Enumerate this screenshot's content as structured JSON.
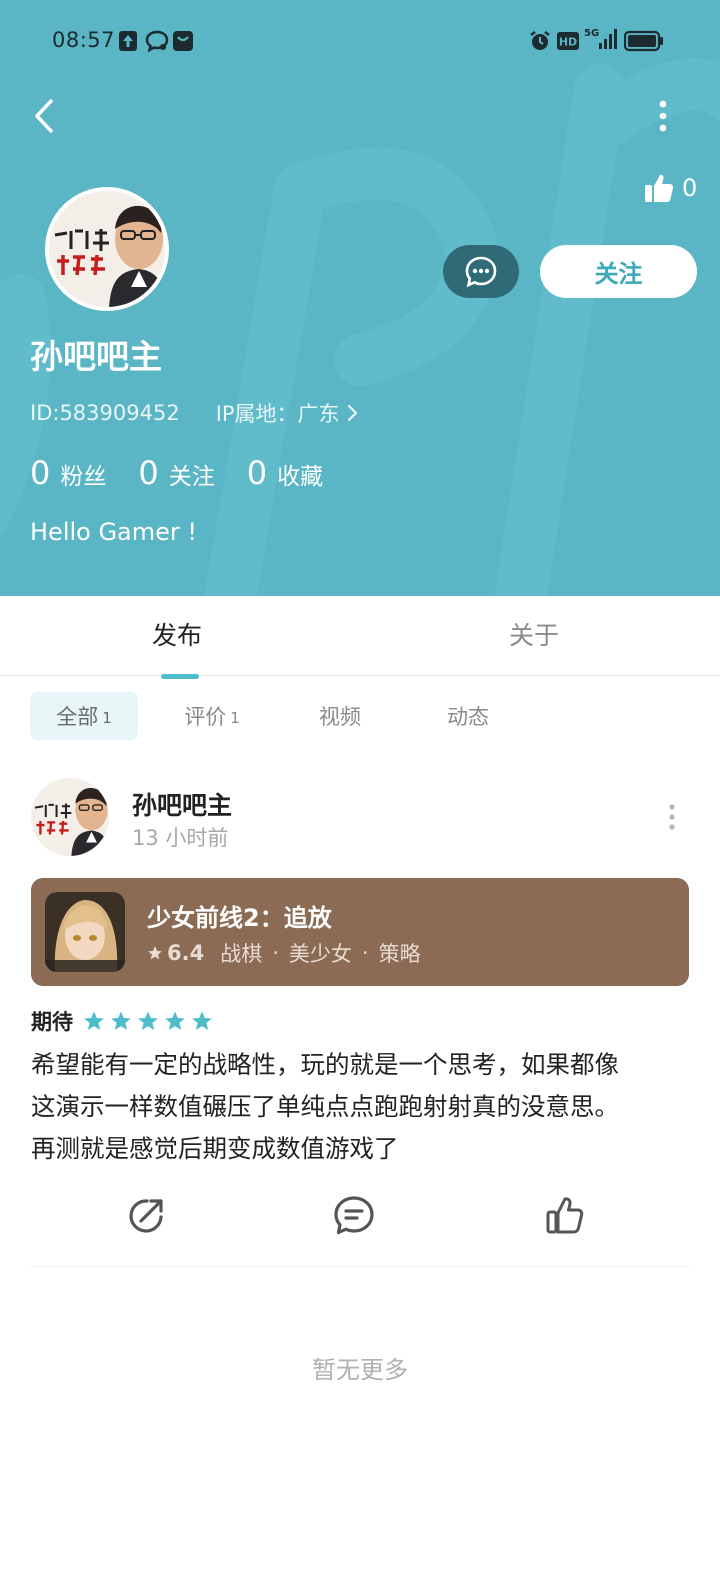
{
  "colors": {
    "header_bg": "#5ab5c5",
    "accent": "#4ebdca",
    "message_button": "#2e6b77",
    "game_card_bg": "#8c6b55"
  },
  "status_bar": {
    "time": "08:57",
    "network": "5G",
    "hd": "HD"
  },
  "header": {
    "like_count": "0",
    "back_icon": "chevron-left-icon",
    "more_icon": "vertical-dots-icon"
  },
  "profile": {
    "name": "孙吧吧主",
    "id_text": "ID:583909452",
    "ip_text": "IP属地：广东",
    "stats": [
      {
        "num": "0",
        "label": "粉丝"
      },
      {
        "num": "0",
        "label": "关注"
      },
      {
        "num": "0",
        "label": "收藏"
      }
    ],
    "bio": "Hello Gamer !",
    "follow_label": "关注"
  },
  "tabs": {
    "main": [
      "发布",
      "关于"
    ],
    "active_main": "发布",
    "sub": [
      {
        "label": "全部",
        "count": "1"
      },
      {
        "label": "评价",
        "count": "1"
      },
      {
        "label": "视频",
        "count": ""
      },
      {
        "label": "动态",
        "count": ""
      }
    ],
    "active_sub": "全部"
  },
  "post": {
    "author": "孙吧吧主",
    "time": "13 小时前",
    "game": {
      "title": "少女前线2：追放",
      "score": "6.4",
      "tags": [
        "战棋",
        "美少女",
        "策略"
      ]
    },
    "rating": {
      "label": "期待",
      "stars": 5
    },
    "text_lines": [
      "希望能有一定的战略性，玩的就是一个思考，如果都像",
      "这演示一样数值碾压了单纯点点跑跑射射真的没意思。",
      "再测就是感觉后期变成数值游戏了"
    ]
  },
  "footer": {
    "no_more": "暂无更多"
  }
}
